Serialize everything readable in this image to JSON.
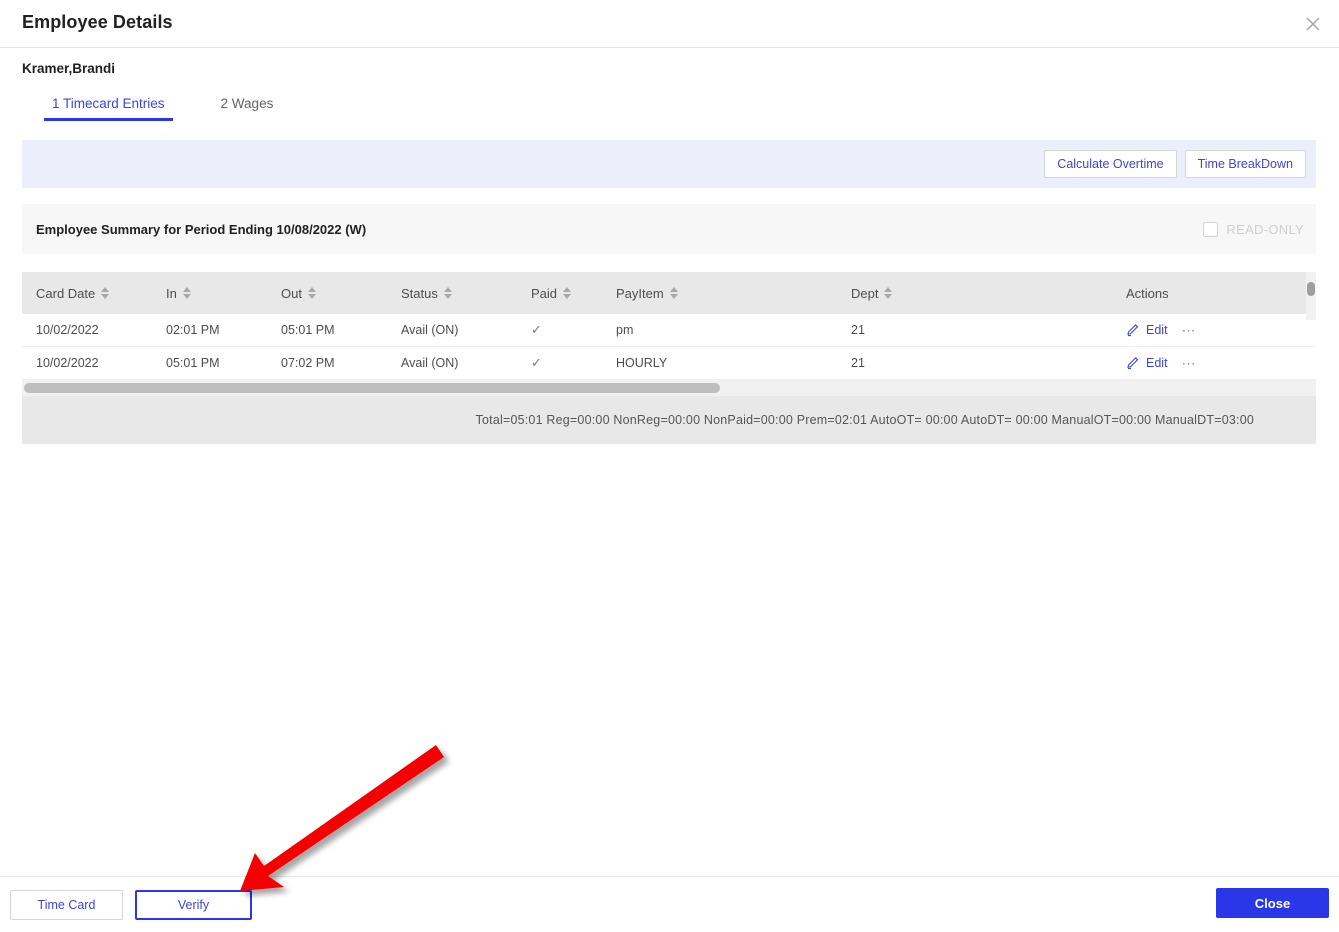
{
  "window": {
    "title": "Employee Details",
    "close_icon": "close-icon"
  },
  "employee": {
    "name": "Kramer,Brandi"
  },
  "tabs": [
    {
      "label": "1 Timecard Entries",
      "active": true
    },
    {
      "label": "2 Wages",
      "active": false
    }
  ],
  "toolbar": {
    "calculate_overtime_label": "Calculate Overtime",
    "time_breakdown_label": "Time BreakDown"
  },
  "summary": {
    "title": "Employee Summary for Period Ending 10/08/2022 (W)",
    "readonly_label": "READ-ONLY",
    "readonly_checked": false
  },
  "table": {
    "columns": [
      {
        "label": "Card Date",
        "sortable": true
      },
      {
        "label": "In",
        "sortable": true
      },
      {
        "label": "Out",
        "sortable": true
      },
      {
        "label": "Status",
        "sortable": true
      },
      {
        "label": "Paid",
        "sortable": true
      },
      {
        "label": "PayItem",
        "sortable": true
      },
      {
        "label": "Dept",
        "sortable": true
      },
      {
        "label": "Actions",
        "sortable": false
      }
    ],
    "rows": [
      {
        "card_date": "10/02/2022",
        "in": "02:01 PM",
        "out": "05:01 PM",
        "status": "Avail (ON)",
        "paid": "✓",
        "payitem": "pm",
        "dept": "21",
        "edit_label": "Edit",
        "more_label": "⋯"
      },
      {
        "card_date": "10/02/2022",
        "in": "05:01 PM",
        "out": "07:02 PM",
        "status": "Avail (ON)",
        "paid": "✓",
        "payitem": "HOURLY",
        "dept": "21",
        "edit_label": "Edit",
        "more_label": "⋯"
      }
    ],
    "totals": "Total=05:01   Reg=00:00   NonReg=00:00   NonPaid=00:00   Prem=02:01   AutoOT= 00:00   AutoDT= 00:00   ManualOT=00:00   ManualDT=03:00"
  },
  "footer": {
    "time_card_label": "Time Card",
    "verify_label": "Verify",
    "close_label": "Close"
  },
  "colors": {
    "accent": "#2a37e8",
    "link": "#3b46e0",
    "toolbar_bg": "#eceefc",
    "header_bg": "#e8e8e8",
    "summary_bg": "#f7f7f7",
    "annotation_arrow": "#f50000"
  }
}
